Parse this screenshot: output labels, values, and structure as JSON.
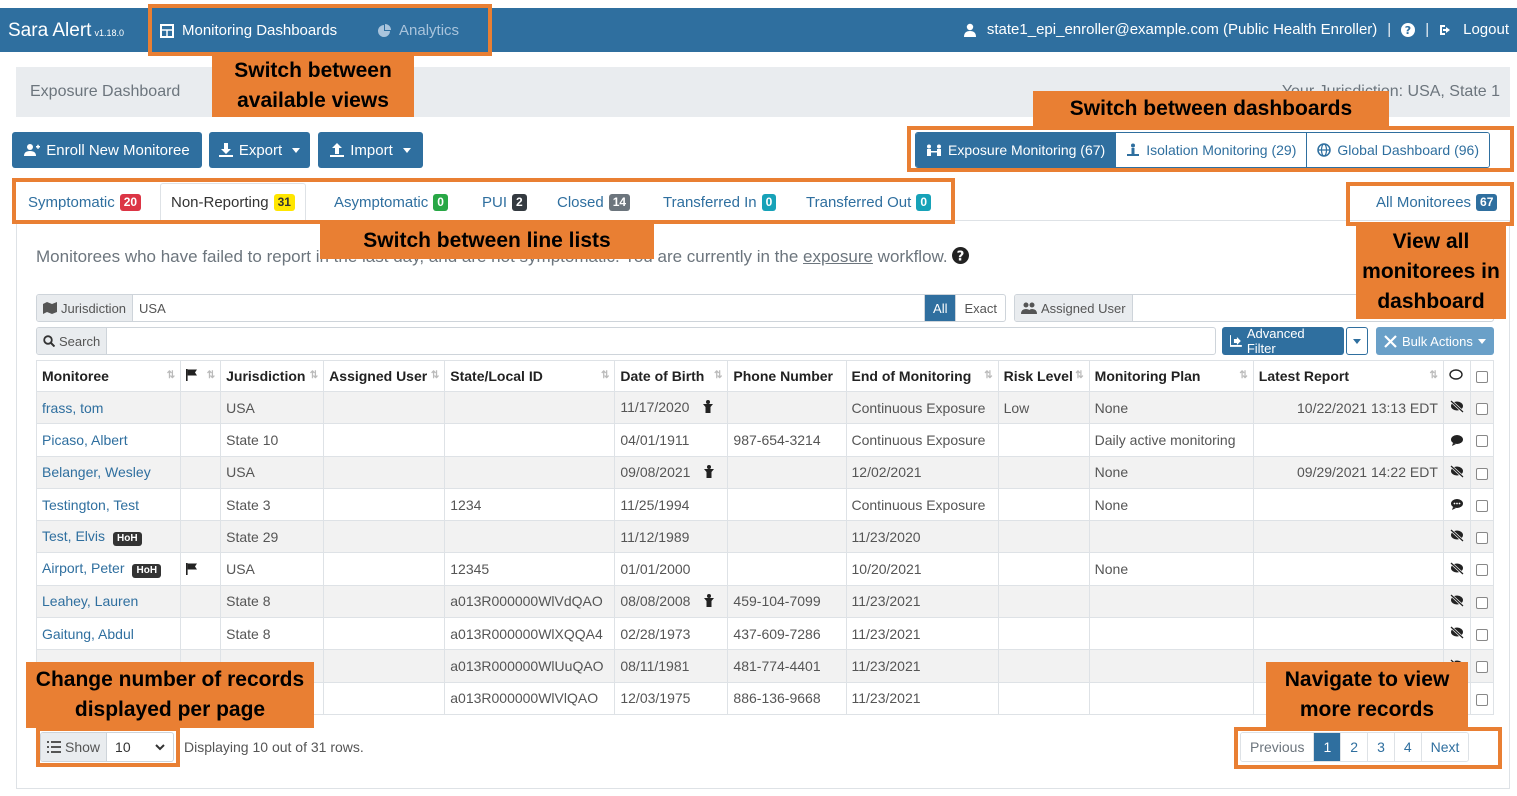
{
  "navbar": {
    "brand": "Sara Alert",
    "version": "v1.18.0",
    "links": [
      {
        "label": "Monitoring Dashboards",
        "active": true
      },
      {
        "label": "Analytics",
        "active": false
      }
    ],
    "user": "state1_epi_enroller@example.com (Public Health Enroller)",
    "logout": "Logout"
  },
  "breadcrumb": {
    "title": "Exposure Dashboard",
    "jurisdiction": "Your Jurisdiction: USA, State 1"
  },
  "actions": {
    "enroll": "Enroll New Monitoree",
    "export": "Export",
    "import": "Import"
  },
  "dashboards": [
    {
      "label": "Exposure Monitoring (67)",
      "active": true
    },
    {
      "label": "Isolation Monitoring (29)",
      "active": false
    },
    {
      "label": "Global Dashboard (96)",
      "active": false
    }
  ],
  "tabs": [
    {
      "label": "Symptomatic",
      "count": "20",
      "color": "#dc3545"
    },
    {
      "label": "Non-Reporting",
      "count": "31",
      "color": "#ffe600"
    },
    {
      "label": "Asymptomatic",
      "count": "0",
      "color": "#28a745"
    },
    {
      "label": "PUI",
      "count": "2",
      "color": "#343a40"
    },
    {
      "label": "Closed",
      "count": "14",
      "color": "#6c757d"
    },
    {
      "label": "Transferred In",
      "count": "0",
      "color": "#17a2b8"
    },
    {
      "label": "Transferred Out",
      "count": "0",
      "color": "#17a2b8"
    }
  ],
  "all_monitorees": {
    "label": "All Monitorees",
    "count": "67"
  },
  "description": {
    "pre": "Monitorees who have failed to report in the last day, and are not symptomatic. You are currently in the ",
    "link": "exposure",
    "post": " workflow."
  },
  "filters": {
    "jurisdiction_label": "Jurisdiction",
    "jurisdiction_value": "USA",
    "all": "All",
    "exact": "Exact",
    "assigned_user": "Assigned User",
    "search": "Search",
    "advanced_filter": "Advanced Filter",
    "bulk_actions": "Bulk Actions"
  },
  "table": {
    "headers": [
      "Monitoree",
      "",
      "Jurisdiction",
      "Assigned User",
      "State/Local ID",
      "Date of Birth",
      "Phone Number",
      "End of Monitoring",
      "Risk Level",
      "Monitoring Plan",
      "Latest Report",
      "",
      ""
    ],
    "rows": [
      {
        "name": "frass, tom",
        "hoh": "",
        "flag": false,
        "jurisdiction": "USA",
        "assigned_user": "",
        "state_id": "",
        "dob": "11/17/2020",
        "minor": true,
        "phone": "",
        "end": "Continuous Exposure",
        "risk": "Low",
        "plan": "None",
        "latest": "10/22/2021 13:13 EDT",
        "comm": "no-messages-icon"
      },
      {
        "name": "Picaso, Albert",
        "hoh": "",
        "flag": false,
        "jurisdiction": "State 10",
        "assigned_user": "",
        "state_id": "",
        "dob": "04/01/1911",
        "minor": false,
        "phone": "987-654-3214",
        "end": "Continuous Exposure",
        "risk": "",
        "plan": "Daily active monitoring",
        "latest": "",
        "comm": "comment-icon"
      },
      {
        "name": "Belanger, Wesley",
        "hoh": "",
        "flag": false,
        "jurisdiction": "USA",
        "assigned_user": "",
        "state_id": "",
        "dob": "09/08/2021",
        "minor": true,
        "phone": "",
        "end": "12/02/2021",
        "risk": "",
        "plan": "None",
        "latest": "09/29/2021 14:22 EDT",
        "comm": "no-messages-icon"
      },
      {
        "name": "Testington, Test",
        "hoh": "",
        "flag": false,
        "jurisdiction": "State 3",
        "assigned_user": "",
        "state_id": "1234",
        "dob": "11/25/1994",
        "minor": false,
        "phone": "",
        "end": "Continuous Exposure",
        "risk": "",
        "plan": "None",
        "latest": "",
        "comm": "comment-dots-icon"
      },
      {
        "name": "Test, Elvis",
        "hoh": "HoH",
        "flag": false,
        "jurisdiction": "State 29",
        "assigned_user": "",
        "state_id": "",
        "dob": "11/12/1989",
        "minor": false,
        "phone": "",
        "end": "11/23/2020",
        "risk": "",
        "plan": "",
        "latest": "",
        "comm": "no-messages-icon"
      },
      {
        "name": "Airport, Peter",
        "hoh": "HoH",
        "flag": true,
        "jurisdiction": "USA",
        "assigned_user": "",
        "state_id": "12345",
        "dob": "01/01/2000",
        "minor": false,
        "phone": "",
        "end": "10/20/2021",
        "risk": "",
        "plan": "None",
        "latest": "",
        "comm": "no-messages-icon"
      },
      {
        "name": "Leahey, Lauren",
        "hoh": "",
        "flag": false,
        "jurisdiction": "State 8",
        "assigned_user": "",
        "state_id": "a013R000000WlVdQAO",
        "dob": "08/08/2008",
        "minor": true,
        "phone": "459-104-7099",
        "end": "11/23/2021",
        "risk": "",
        "plan": "",
        "latest": "",
        "comm": "no-messages-icon"
      },
      {
        "name": "Gaitung, Abdul",
        "hoh": "",
        "flag": false,
        "jurisdiction": "State 8",
        "assigned_user": "",
        "state_id": "a013R000000WlXQQA4",
        "dob": "02/28/1973",
        "minor": false,
        "phone": "437-609-7286",
        "end": "11/23/2021",
        "risk": "",
        "plan": "",
        "latest": "",
        "comm": "no-messages-icon"
      },
      {
        "name": "",
        "hoh": "",
        "flag": false,
        "jurisdiction": "",
        "assigned_user": "",
        "state_id": "a013R000000WlUuQAO",
        "dob": "08/11/1981",
        "minor": false,
        "phone": "481-774-4401",
        "end": "11/23/2021",
        "risk": "",
        "plan": "",
        "latest": "",
        "comm": "no-messages-icon"
      },
      {
        "name": "",
        "hoh": "",
        "flag": false,
        "jurisdiction": "",
        "assigned_user": "",
        "state_id": "a013R000000WlVlQAO",
        "dob": "12/03/1975",
        "minor": false,
        "phone": "886-136-9668",
        "end": "11/23/2021",
        "risk": "",
        "plan": "",
        "latest": "",
        "comm": ""
      }
    ]
  },
  "footer": {
    "show": "Show",
    "per_page": "10",
    "displaying": "Displaying 10 out of 31 rows.",
    "pages": [
      "Previous",
      "1",
      "2",
      "3",
      "4",
      "Next"
    ]
  },
  "callouts": {
    "views": "Switch between available views",
    "dashboards": "Switch between dashboards",
    "line_lists": "Switch between line lists",
    "view_all": "View all monitorees in dashboard",
    "records": "Change number of records displayed per page",
    "navigate": "Navigate to view more records"
  },
  "colors": {
    "primary": "#2f6f9f",
    "callout": "#e97f33"
  }
}
